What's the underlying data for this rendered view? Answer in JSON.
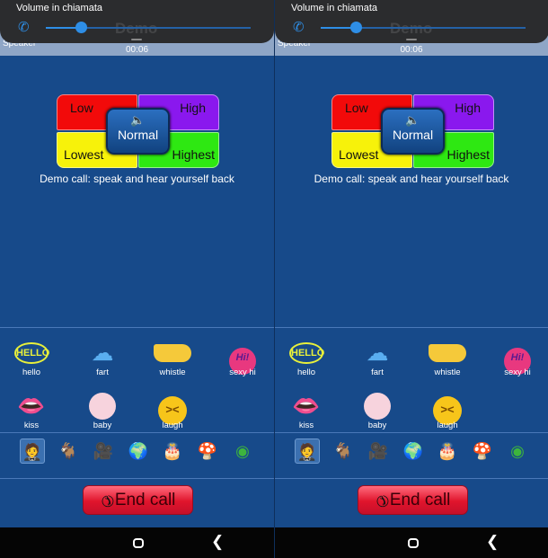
{
  "screens": [
    {
      "volume_panel": {
        "title": "Volume in chiamata",
        "call_icon": "phone-icon",
        "level_percent": 17,
        "ghost_text": "Demo",
        "accent": "#2e8ee6"
      },
      "call": {
        "speaker_label": "Speaker",
        "timer": "00:06"
      },
      "volume_selector": {
        "low": "Low",
        "high": "High",
        "lowest": "Lowest",
        "highest": "Highest",
        "normal": "Normal",
        "speaker_icon": "speaker-icon"
      },
      "caption": "Demo call: speak and hear yourself back",
      "sounds": [
        {
          "label": "hello",
          "icon": "hello-bubble-icon"
        },
        {
          "label": "fart",
          "icon": "fart-cloud-icon"
        },
        {
          "label": "whistle",
          "icon": "whistle-icon"
        },
        {
          "label": "sexy hi",
          "icon": "hi-bubble-icon"
        },
        {
          "label": "kiss",
          "icon": "lips-icon"
        },
        {
          "label": "baby",
          "icon": "baby-icon"
        },
        {
          "label": "laugh",
          "icon": "laugh-emoji-icon"
        }
      ],
      "categories": [
        "person-icon",
        "goat-icon",
        "camera-icon",
        "globe-icon",
        "cake-icon",
        "explosion-icon",
        "green-whistle-icon"
      ],
      "end_call_label": "End call"
    },
    {
      "volume_panel": {
        "title": "Volume in chiamata",
        "call_icon": "phone-icon",
        "level_percent": 17,
        "ghost_text": "Demo",
        "accent": "#2e8ee6"
      },
      "call": {
        "speaker_label": "Speaker",
        "timer": "00:06"
      },
      "volume_selector": {
        "low": "Low",
        "high": "High",
        "lowest": "Lowest",
        "highest": "Highest",
        "normal": "Normal",
        "speaker_icon": "speaker-icon"
      },
      "caption": "Demo call: speak and hear yourself back",
      "sounds": [
        {
          "label": "hello",
          "icon": "hello-bubble-icon"
        },
        {
          "label": "fart",
          "icon": "fart-cloud-icon"
        },
        {
          "label": "whistle",
          "icon": "whistle-icon"
        },
        {
          "label": "sexy hi",
          "icon": "hi-bubble-icon"
        },
        {
          "label": "kiss",
          "icon": "lips-icon"
        },
        {
          "label": "baby",
          "icon": "baby-icon"
        },
        {
          "label": "laugh",
          "icon": "laugh-emoji-icon"
        }
      ],
      "categories": [
        "person-icon",
        "goat-icon",
        "camera-icon",
        "globe-icon",
        "cake-icon",
        "explosion-icon",
        "green-whistle-icon"
      ],
      "end_call_label": "End call"
    }
  ]
}
